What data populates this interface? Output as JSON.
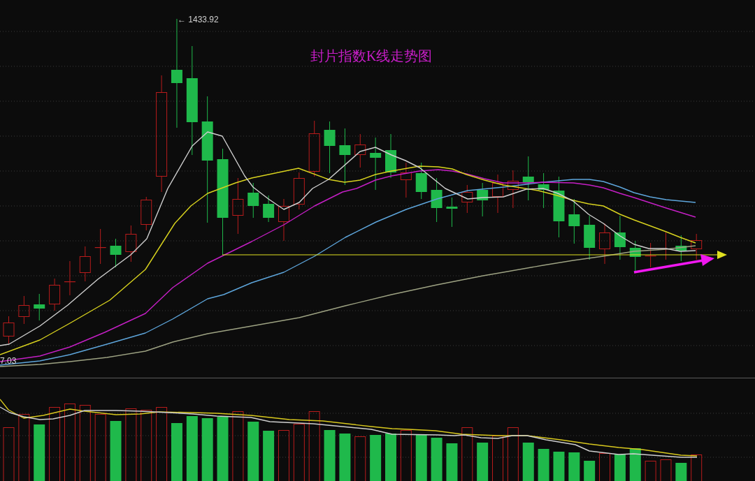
{
  "chart": {
    "title": "封片指数K线走势图",
    "high_label": "← 1433.92",
    "low_label": "7.03"
  }
}
